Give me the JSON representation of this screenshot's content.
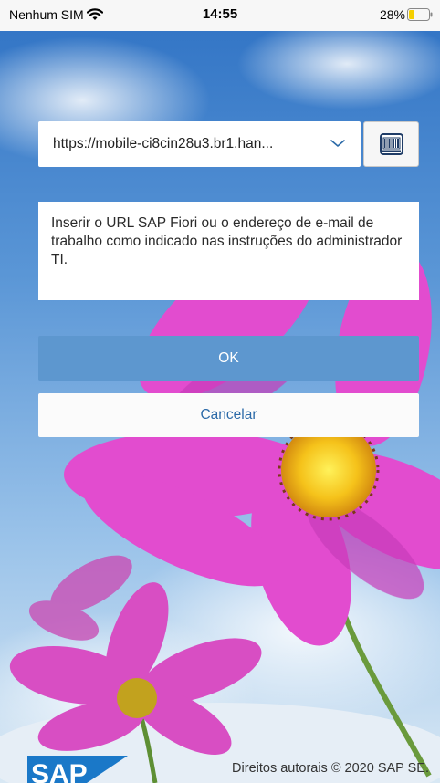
{
  "status_bar": {
    "carrier": "Nenhum SIM",
    "time": "14:55",
    "battery_percent": "28%",
    "battery_level": 0.28
  },
  "url_field": {
    "value": "https://mobile-ci8cin28u3.br1.han...",
    "dropdown_icon": "chevron-down-icon"
  },
  "scan_button": {
    "icon": "barcode-icon"
  },
  "hint": {
    "text": "Inserir o URL SAP Fiori ou o endereço de e-mail de trabalho como indicado nas instruções do administrador TI."
  },
  "buttons": {
    "ok_label": "OK",
    "cancel_label": "Cancelar"
  },
  "footer": {
    "logo_text": "SAP",
    "copyright": "Direitos autorais © 2020 SAP SE."
  },
  "colors": {
    "primary": "#5d97cf",
    "cancel_text": "#2b6aa8",
    "sap_logo": "#1a78c8"
  }
}
